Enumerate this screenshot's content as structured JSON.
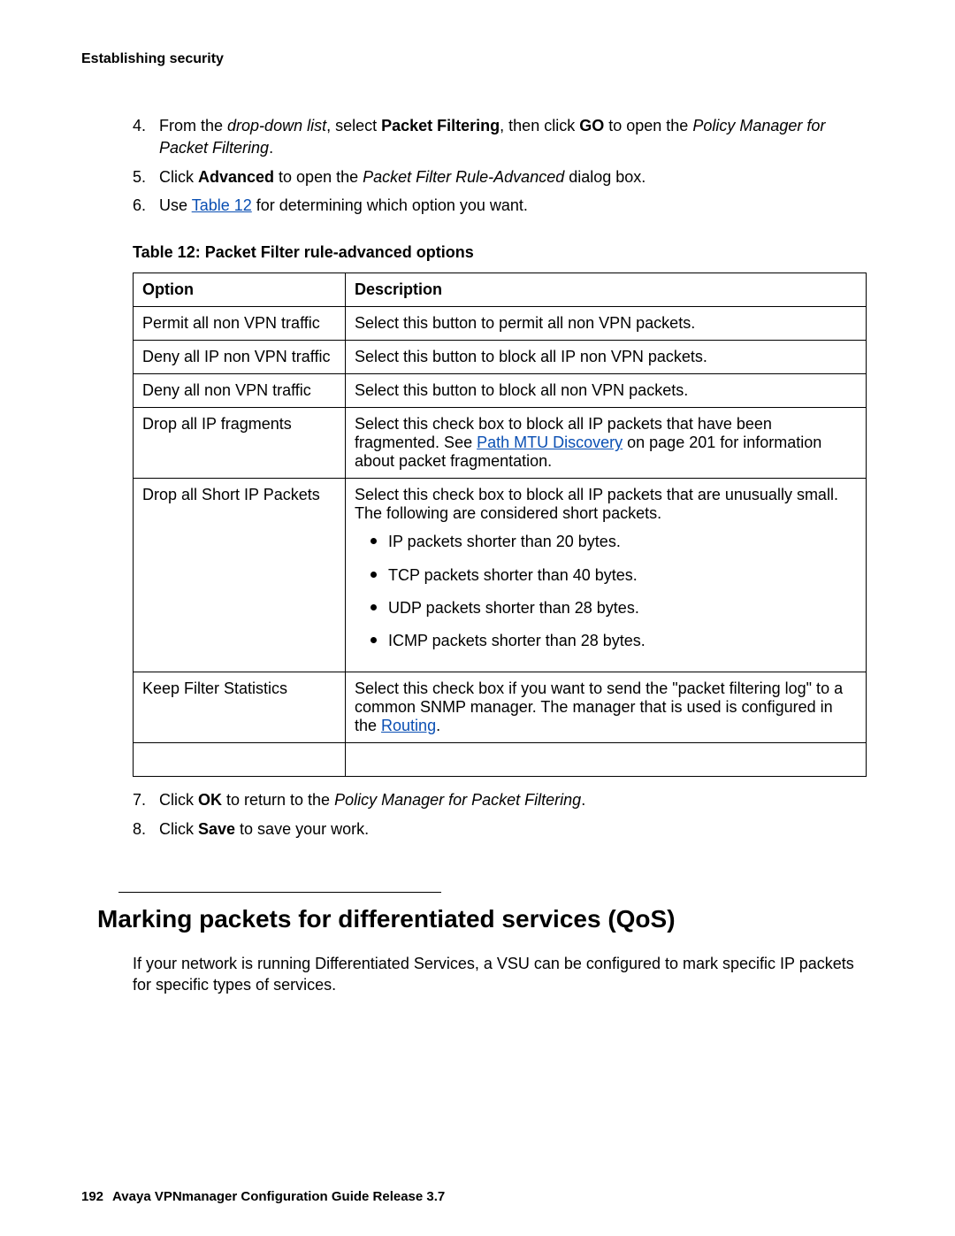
{
  "header": "Establishing security",
  "steps_a": {
    "s4": {
      "pre": "From the ",
      "italic1": "drop-down list",
      "mid1": ", select ",
      "bold1": "Packet Filtering",
      "mid2": ", then click ",
      "bold2": "GO",
      "mid3": " to open the ",
      "italic2": "Policy Manager for Packet Filtering",
      "end": "."
    },
    "s5": {
      "pre": "Click ",
      "bold1": "Advanced",
      "mid1": " to open the ",
      "italic1": "Packet Filter Rule-Advanced",
      "end": " dialog box."
    },
    "s6": {
      "pre": "Use ",
      "link1": "Table 12",
      "end": " for determining which option you want."
    }
  },
  "table": {
    "caption": "Table 12: Packet Filter rule-advanced options",
    "h1": "Option",
    "h2": "Description",
    "rows": [
      {
        "opt": "Permit all non VPN traffic",
        "desc": "Select this button to permit all non VPN packets."
      },
      {
        "opt": "Deny all IP non VPN traffic",
        "desc": "Select this button to block all IP non VPN packets."
      },
      {
        "opt": "Deny all non VPN traffic",
        "desc": "Select this button to block all non VPN packets."
      }
    ],
    "r3": {
      "opt": "Drop all IP fragments",
      "pre": "Select this check box to block all IP packets that have been fragmented. See ",
      "link": "Path MTU Discovery",
      "mid": " on page 201",
      "end": " for information about packet fragmentation."
    },
    "r4": {
      "opt": "Drop all Short IP Packets",
      "desc": "Select this check box to block all IP packets that are unusually small. The following are considered short packets.",
      "bullets": [
        "IP packets shorter than 20 bytes.",
        "TCP packets shorter than 40 bytes.",
        "UDP packets shorter than 28 bytes.",
        "ICMP packets shorter than 28 bytes."
      ]
    },
    "r5": {
      "opt": "Keep Filter Statistics",
      "pre": "Select this check box if you want to send the \"packet filtering log\" to a common SNMP manager. The manager that is used is configured in the ",
      "link": "Routing",
      "end": "."
    }
  },
  "steps_b": {
    "s7": {
      "pre": "Click ",
      "bold1": "OK",
      "mid1": " to return to the ",
      "italic1": "Policy Manager for Packet Filtering",
      "end": "."
    },
    "s8": {
      "pre": "Click ",
      "bold1": "Save",
      "end": " to save your work."
    }
  },
  "section": {
    "title": "Marking packets for differentiated services (QoS)",
    "body": "If your network is running Differentiated Services, a VSU can be configured to mark specific IP packets for specific types of services."
  },
  "footer": {
    "page": "192",
    "title": "Avaya VPNmanager Configuration Guide Release 3.7"
  }
}
